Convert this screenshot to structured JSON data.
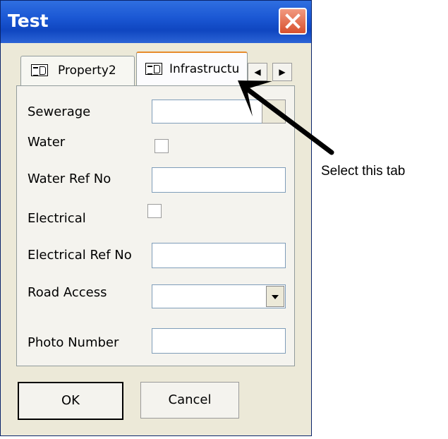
{
  "window": {
    "title": "Test"
  },
  "tabs": [
    {
      "label": "Property2",
      "icon": "property-tab-icon"
    },
    {
      "label": "Infrastructu",
      "icon": "property-tab-icon"
    }
  ],
  "fields": {
    "sewerage_label": "Sewerage",
    "water_label": "Water",
    "water_ref_label": "Water Ref No",
    "electrical_label": "Electrical",
    "electrical_ref_label": "Electrical Ref No",
    "road_access_label": "Road Access",
    "photo_number_label": "Photo Number"
  },
  "buttons": {
    "ok_label": "OK",
    "cancel_label": "Cancel"
  },
  "annotation": {
    "text": "Select this tab"
  },
  "colors": {
    "titlebar": "#1b58d4",
    "close_button": "#d7502e",
    "dialog_bg": "#ece9d8",
    "active_tab_accent": "#e68b2c"
  }
}
